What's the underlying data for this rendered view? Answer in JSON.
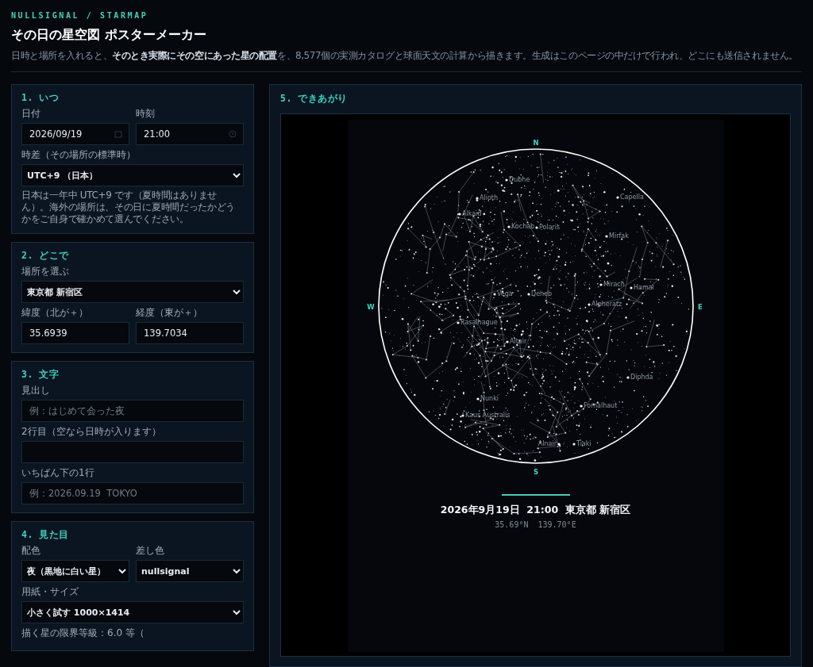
{
  "header": {
    "brand": "NULLSIGNAL / STARMAP",
    "title": "その日の星空図 ポスターメーカー",
    "description": "日時と場所を入れると、**そのとき実際にその空にあった星の配置**を、8,577個の実測カタログと球面天文の計算から描きます。生成はこのページの中だけで行われ、どこにも送信されません。"
  },
  "panels": [
    {
      "title": "1. いつ",
      "rows": [
        [
          {
            "kind": "date",
            "label": "日付",
            "value": "2026/09/19"
          },
          {
            "kind": "time",
            "label": "時刻",
            "value": "21:00"
          }
        ],
        [
          {
            "kind": "select",
            "label": "時差（その場所の標準時）",
            "value": "UTC+9 （日本）"
          }
        ],
        [
          {
            "kind": "note",
            "text": "日本は一年中 UTC+9 です（夏時間はありません）。海外の場所は、その日に夏時間だったかどうかをご自身で確かめて選んでください。"
          }
        ]
      ]
    },
    {
      "title": "2. どこで",
      "rows": [
        [
          {
            "kind": "select",
            "label": "場所を選ぶ",
            "value": "東京都 新宿区"
          }
        ],
        [
          {
            "kind": "text",
            "label": "緯度（北が＋）",
            "value": "35.6939"
          },
          {
            "kind": "text",
            "label": "経度（東が＋）",
            "value": "139.7034"
          }
        ]
      ]
    },
    {
      "title": "3. 文字",
      "rows": [
        [
          {
            "kind": "text",
            "label": "見出し",
            "placeholder": "例：はじめて会った夜"
          }
        ],
        [
          {
            "kind": "text",
            "label": "2行目（空なら日時が入ります）"
          }
        ],
        [
          {
            "kind": "text",
            "label": "いちばん下の1行",
            "placeholder": "例：2026.09.19  TOKYO"
          }
        ]
      ]
    },
    {
      "title": "4. 見た目",
      "rows": [
        [
          {
            "kind": "select",
            "label": "配色",
            "value": "夜（黒地に白い星）"
          },
          {
            "kind": "select",
            "label": "差し色",
            "value": "nullsignal"
          }
        ],
        [
          {
            "kind": "select",
            "label": "用紙・サイズ",
            "value": "小さく試す 1000×1414"
          }
        ],
        [
          {
            "kind": "caption",
            "text": "描く星の限界等級：6.0 等（"
          }
        ]
      ]
    }
  ],
  "preview": {
    "title": "5. できあがり",
    "poster": {
      "compass": {
        "north": "N",
        "east": "E",
        "south": "S",
        "west": "W"
      },
      "star_labels": [
        "Dubhe",
        "Alioth",
        "Alkaid",
        "Capella",
        "Kochab",
        "Polaris",
        "Mirfak",
        "Mirach",
        "Hamal",
        "Vega",
        "Deneb",
        "Alpheratz",
        "Rasalhague",
        "Altair",
        "Diphda",
        "Nunki",
        "Kaus Australis",
        "Fomalhaut",
        "Alnair",
        "Tiaki"
      ],
      "caption": "2026年9月19日  21:00  東京都 新宿区",
      "coordinates": "35.69°N  139.70°E"
    }
  }
}
